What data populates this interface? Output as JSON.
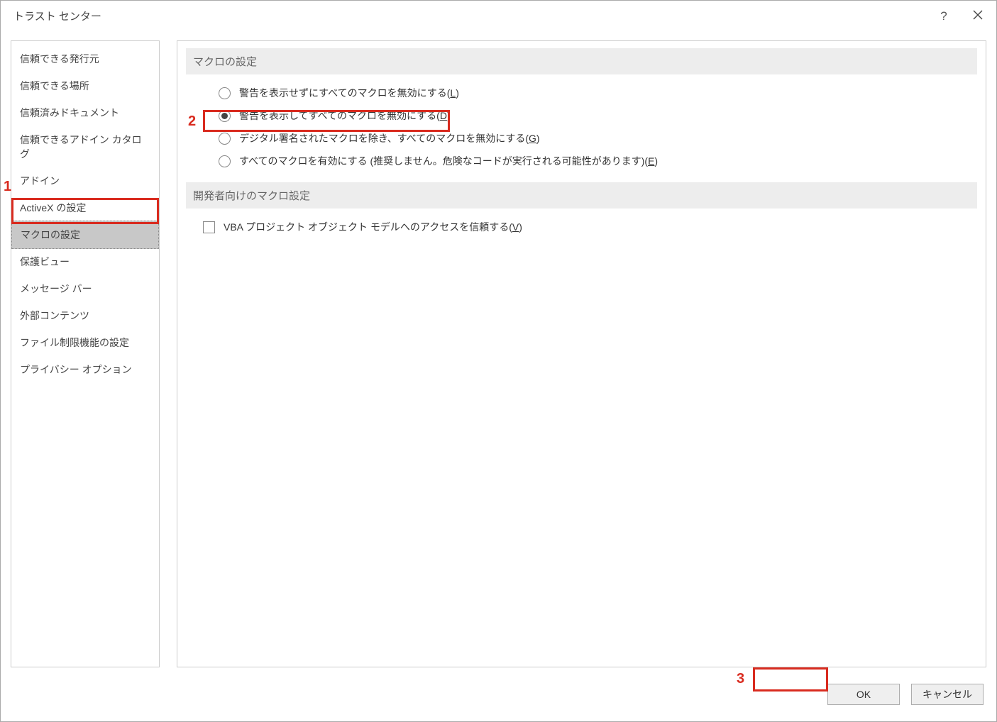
{
  "title": "トラスト センター",
  "sidebar": {
    "items": [
      {
        "label": "信頼できる発行元"
      },
      {
        "label": "信頼できる場所"
      },
      {
        "label": "信頼済みドキュメント"
      },
      {
        "label": "信頼できるアドイン カタログ"
      },
      {
        "label": "アドイン"
      },
      {
        "label": "ActiveX の設定"
      },
      {
        "label": "マクロの設定"
      },
      {
        "label": "保護ビュー"
      },
      {
        "label": "メッセージ バー"
      },
      {
        "label": "外部コンテンツ"
      },
      {
        "label": "ファイル制限機能の設定"
      },
      {
        "label": "プライバシー オプション"
      }
    ]
  },
  "main": {
    "section1": {
      "heading": "マクロの設定",
      "options": [
        {
          "text": "警告を表示せずにすべてのマクロを無効にする(",
          "key": "L",
          "suffix": ")",
          "checked": false
        },
        {
          "text": "警告を表示してすべてのマクロを無効にする(",
          "key": "D",
          "suffix": ")",
          "checked": true
        },
        {
          "text": "デジタル署名されたマクロを除き、すべてのマクロを無効にする(",
          "key": "G",
          "suffix": ")",
          "checked": false
        },
        {
          "text": "すべてのマクロを有効にする (推奨しません。危険なコードが実行される可能性があります)(",
          "key": "E",
          "suffix": ")",
          "checked": false
        }
      ]
    },
    "section2": {
      "heading": "開発者向けのマクロ設定",
      "checkbox": {
        "text": "VBA プロジェクト オブジェクト モデルへのアクセスを信頼する(",
        "key": "V",
        "suffix": ")"
      }
    }
  },
  "footer": {
    "ok": "OK",
    "cancel": "キャンセル"
  },
  "annotations": {
    "one": "1",
    "two": "2",
    "three": "3"
  }
}
